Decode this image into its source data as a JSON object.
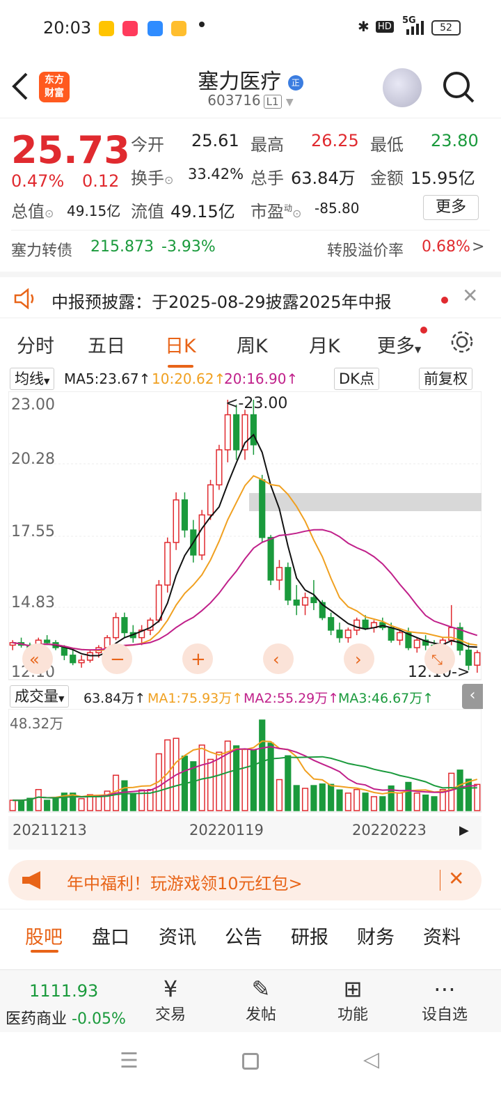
{
  "status": {
    "time": "20:03",
    "battery": "52",
    "network": "5G"
  },
  "header": {
    "name": "塞力医疗",
    "badge": "正",
    "code": "603716",
    "level": "L1",
    "logo_line1": "东方",
    "logo_line2": "财富"
  },
  "quote": {
    "price": "25.73",
    "change_pct": "0.47%",
    "change": "0.12",
    "open_label": "今开",
    "open": "25.61",
    "high_label": "最高",
    "high": "26.25",
    "low_label": "最低",
    "low": "23.80",
    "turnover_label": "换手",
    "turnover": "33.42%",
    "vol_label": "总手",
    "vol": "63.84万",
    "amount_label": "金额",
    "amount": "15.95亿",
    "mktcap_label": "总值",
    "mktcap": "49.15亿",
    "float_label": "流值",
    "float": "49.15亿",
    "pe_label": "市盈",
    "pe_sup": "动",
    "pe": "-85.80",
    "more": "更多"
  },
  "convertible": {
    "name": "塞力转债",
    "price": "215.873",
    "pct": "-3.93%",
    "premium_label": "转股溢价率",
    "premium": "0.68%",
    "arrow": ">"
  },
  "notice": {
    "text": "中报预披露：于2025-08-29披露2025年中报"
  },
  "tabs": [
    "分时",
    "五日",
    "日K",
    "周K",
    "月K",
    "更多"
  ],
  "ma": {
    "selector": "均线",
    "ma5": "MA5:23.67",
    "ma10": "10:20.62",
    "ma20": "20:16.90",
    "dk": "DK点",
    "fq": "前复权"
  },
  "kchart": {
    "y_labels": [
      "23.00",
      "20.28",
      "17.55",
      "14.83",
      "12.10"
    ],
    "high_mark": "<-23.00",
    "low_mark": "12.10->"
  },
  "volume": {
    "selector": "成交量",
    "vol": "63.84万",
    "ma1": "MA1:75.93万",
    "ma2": "MA2:55.29万",
    "ma3": "MA3:46.67万",
    "max_label": "48.32万"
  },
  "dates": [
    "20211213",
    "20220119",
    "20220223"
  ],
  "ad": {
    "text": "年中福利！玩游戏领10元红包>"
  },
  "bottom_tabs": [
    "股吧",
    "盘口",
    "资讯",
    "公告",
    "研报",
    "财务",
    "资料"
  ],
  "bottombar": {
    "index_value": "1111.93",
    "index_name": "医药商业",
    "index_pct": "-0.05%",
    "trade": "交易",
    "post": "发帖",
    "func": "功能",
    "watch": "设自选"
  },
  "colors": {
    "up": "#e02a2f",
    "down": "#1a9a3c",
    "accent": "#e86418"
  },
  "chart_data": {
    "type": "candlestick",
    "ylim": [
      12.1,
      23.0
    ],
    "candles": [
      [
        13.2,
        13.4,
        13.0,
        13.3
      ],
      [
        13.3,
        13.5,
        13.1,
        13.2
      ],
      [
        13.2,
        13.3,
        12.9,
        13.0
      ],
      [
        13.0,
        13.5,
        12.8,
        13.4
      ],
      [
        13.4,
        13.6,
        13.2,
        13.3
      ],
      [
        13.3,
        13.4,
        13.0,
        13.1
      ],
      [
        13.1,
        13.2,
        12.6,
        12.8
      ],
      [
        12.8,
        13.0,
        12.4,
        12.5
      ],
      [
        12.5,
        12.8,
        12.3,
        12.6
      ],
      [
        12.6,
        13.0,
        12.5,
        12.9
      ],
      [
        12.9,
        13.2,
        12.7,
        13.1
      ],
      [
        13.1,
        13.6,
        13.0,
        13.5
      ],
      [
        13.5,
        14.5,
        13.4,
        14.3
      ],
      [
        14.3,
        14.5,
        13.5,
        13.7
      ],
      [
        13.7,
        14.0,
        13.3,
        13.5
      ],
      [
        13.5,
        14.0,
        13.2,
        13.8
      ],
      [
        13.8,
        14.3,
        13.6,
        14.2
      ],
      [
        14.2,
        15.8,
        14.1,
        15.6
      ],
      [
        15.6,
        17.5,
        15.3,
        17.3
      ],
      [
        17.3,
        19.3,
        17.0,
        19.0
      ],
      [
        19.0,
        19.3,
        17.5,
        17.8
      ],
      [
        17.8,
        18.2,
        16.5,
        16.8
      ],
      [
        16.8,
        18.6,
        16.6,
        18.4
      ],
      [
        18.4,
        19.8,
        18.2,
        19.6
      ],
      [
        19.6,
        21.2,
        19.4,
        21.0
      ],
      [
        21.0,
        23.0,
        20.5,
        22.4
      ],
      [
        22.4,
        22.8,
        20.6,
        21.0
      ],
      [
        21.0,
        22.6,
        20.6,
        22.4
      ],
      [
        22.4,
        23.0,
        20.8,
        21.2
      ],
      [
        19.8,
        20.0,
        17.3,
        17.5
      ],
      [
        17.5,
        17.6,
        15.6,
        15.8
      ],
      [
        15.8,
        16.6,
        15.4,
        16.3
      ],
      [
        16.3,
        16.5,
        14.8,
        15.0
      ],
      [
        15.0,
        15.6,
        14.4,
        14.8
      ],
      [
        14.8,
        15.3,
        14.4,
        15.1
      ],
      [
        15.1,
        15.8,
        14.6,
        14.9
      ],
      [
        14.9,
        15.0,
        14.2,
        14.3
      ],
      [
        14.3,
        14.5,
        13.6,
        13.8
      ],
      [
        13.8,
        14.1,
        13.3,
        13.5
      ],
      [
        13.5,
        13.9,
        13.3,
        13.8
      ],
      [
        13.8,
        14.3,
        13.6,
        14.2
      ],
      [
        14.2,
        14.4,
        13.8,
        13.9
      ],
      [
        13.9,
        14.2,
        13.7,
        14.1
      ],
      [
        14.1,
        14.3,
        13.8,
        13.9
      ],
      [
        13.9,
        14.1,
        13.3,
        13.4
      ],
      [
        13.4,
        13.8,
        13.2,
        13.7
      ],
      [
        13.7,
        13.9,
        13.0,
        13.1
      ],
      [
        13.1,
        13.5,
        12.9,
        13.4
      ],
      [
        13.4,
        13.6,
        13.0,
        13.2
      ],
      [
        13.2,
        13.4,
        12.9,
        13.0
      ],
      [
        13.0,
        13.5,
        12.8,
        13.4
      ],
      [
        13.4,
        14.8,
        13.2,
        13.9
      ],
      [
        13.9,
        14.1,
        12.8,
        13.0
      ],
      [
        13.0,
        13.3,
        12.2,
        12.4
      ],
      [
        12.4,
        13.0,
        12.1,
        12.9
      ]
    ],
    "ma_series": [
      {
        "name": "MA5",
        "color": "#111111"
      },
      {
        "name": "MA10",
        "color": "#f0a020"
      },
      {
        "name": "MA20",
        "color": "#c0208a"
      }
    ]
  }
}
